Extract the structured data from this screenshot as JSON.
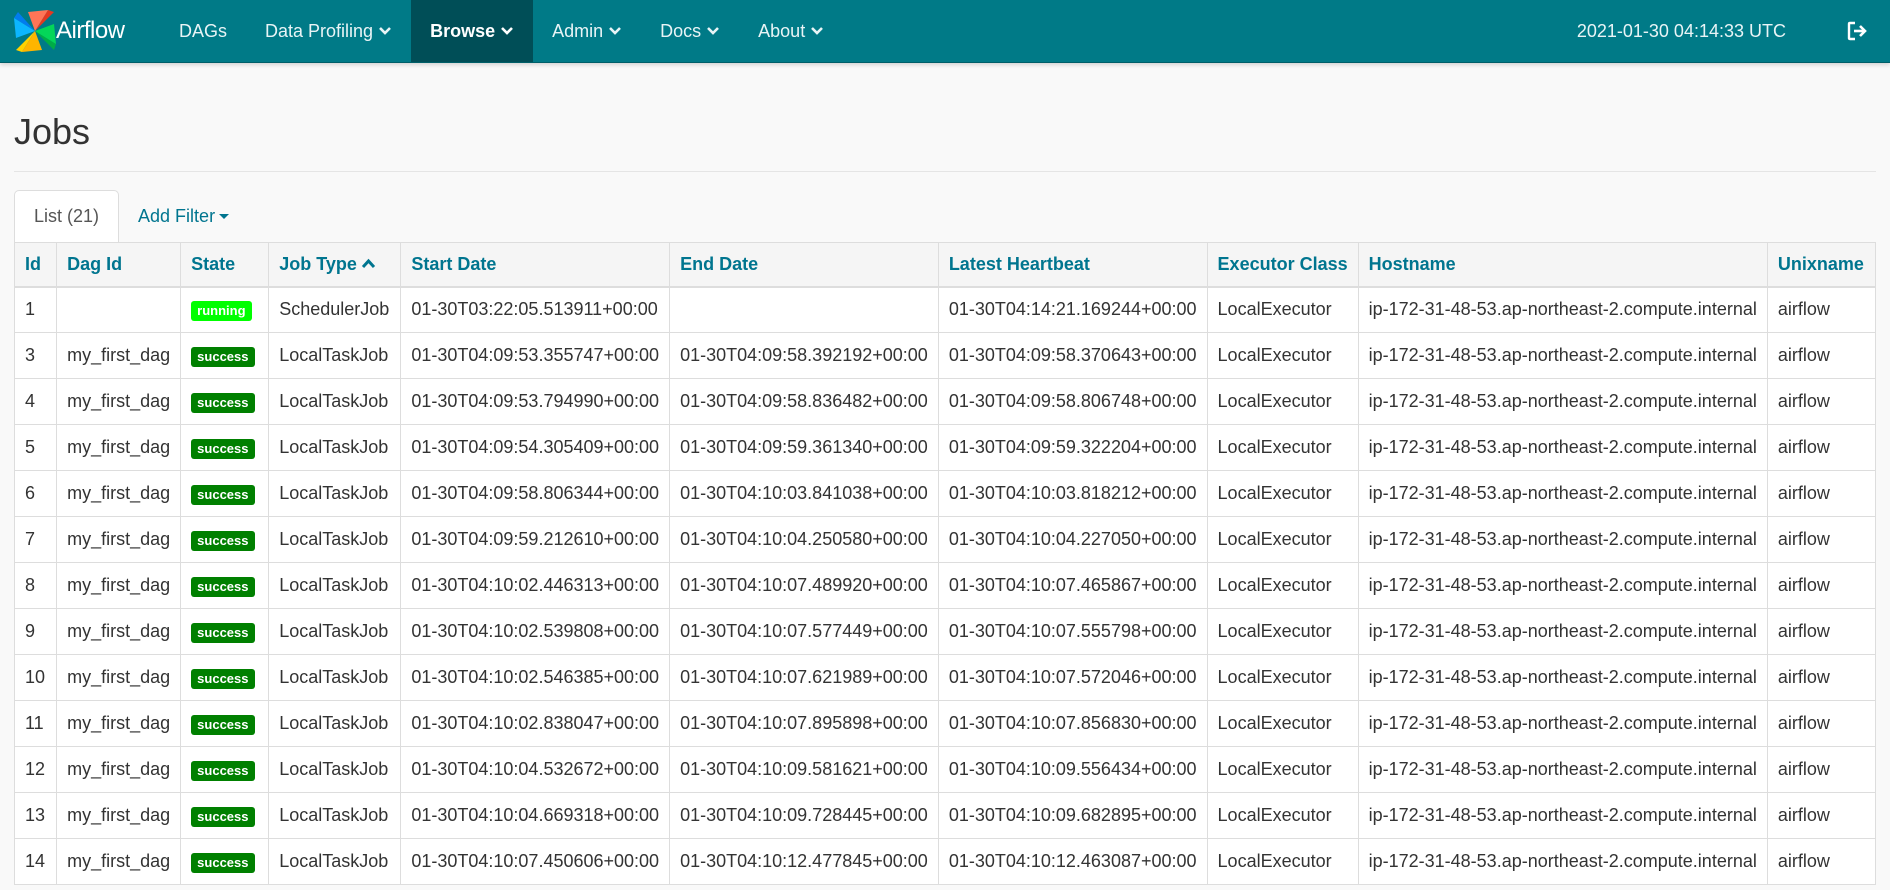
{
  "navbar": {
    "brand": "Airflow",
    "items": [
      {
        "label": "DAGs",
        "dropdown": false,
        "active": false
      },
      {
        "label": "Data Profiling",
        "dropdown": true,
        "active": false
      },
      {
        "label": "Browse",
        "dropdown": true,
        "active": true
      },
      {
        "label": "Admin",
        "dropdown": true,
        "active": false
      },
      {
        "label": "Docs",
        "dropdown": true,
        "active": false
      },
      {
        "label": "About",
        "dropdown": true,
        "active": false
      }
    ],
    "clock": "2021-01-30 04:14:33 UTC",
    "logout_icon": "sign-out-icon"
  },
  "page": {
    "title": "Jobs"
  },
  "tabs": {
    "list_label": "List (21)",
    "add_filter_label": "Add Filter"
  },
  "table": {
    "columns": [
      "Id",
      "Dag Id",
      "State",
      "Job Type",
      "Start Date",
      "End Date",
      "Latest Heartbeat",
      "Executor Class",
      "Hostname",
      "Unixname"
    ],
    "sorted_column": "Job Type",
    "rows": [
      {
        "id": "1",
        "dag_id": "",
        "state": "running",
        "job_type": "SchedulerJob",
        "start_date": "01-30T03:22:05.513911+00:00",
        "end_date": "",
        "latest_heartbeat": "01-30T04:14:21.169244+00:00",
        "executor_class": "LocalExecutor",
        "hostname": "ip-172-31-48-53.ap-northeast-2.compute.internal",
        "unixname": "airflow"
      },
      {
        "id": "3",
        "dag_id": "my_first_dag",
        "state": "success",
        "job_type": "LocalTaskJob",
        "start_date": "01-30T04:09:53.355747+00:00",
        "end_date": "01-30T04:09:58.392192+00:00",
        "latest_heartbeat": "01-30T04:09:58.370643+00:00",
        "executor_class": "LocalExecutor",
        "hostname": "ip-172-31-48-53.ap-northeast-2.compute.internal",
        "unixname": "airflow"
      },
      {
        "id": "4",
        "dag_id": "my_first_dag",
        "state": "success",
        "job_type": "LocalTaskJob",
        "start_date": "01-30T04:09:53.794990+00:00",
        "end_date": "01-30T04:09:58.836482+00:00",
        "latest_heartbeat": "01-30T04:09:58.806748+00:00",
        "executor_class": "LocalExecutor",
        "hostname": "ip-172-31-48-53.ap-northeast-2.compute.internal",
        "unixname": "airflow"
      },
      {
        "id": "5",
        "dag_id": "my_first_dag",
        "state": "success",
        "job_type": "LocalTaskJob",
        "start_date": "01-30T04:09:54.305409+00:00",
        "end_date": "01-30T04:09:59.361340+00:00",
        "latest_heartbeat": "01-30T04:09:59.322204+00:00",
        "executor_class": "LocalExecutor",
        "hostname": "ip-172-31-48-53.ap-northeast-2.compute.internal",
        "unixname": "airflow"
      },
      {
        "id": "6",
        "dag_id": "my_first_dag",
        "state": "success",
        "job_type": "LocalTaskJob",
        "start_date": "01-30T04:09:58.806344+00:00",
        "end_date": "01-30T04:10:03.841038+00:00",
        "latest_heartbeat": "01-30T04:10:03.818212+00:00",
        "executor_class": "LocalExecutor",
        "hostname": "ip-172-31-48-53.ap-northeast-2.compute.internal",
        "unixname": "airflow"
      },
      {
        "id": "7",
        "dag_id": "my_first_dag",
        "state": "success",
        "job_type": "LocalTaskJob",
        "start_date": "01-30T04:09:59.212610+00:00",
        "end_date": "01-30T04:10:04.250580+00:00",
        "latest_heartbeat": "01-30T04:10:04.227050+00:00",
        "executor_class": "LocalExecutor",
        "hostname": "ip-172-31-48-53.ap-northeast-2.compute.internal",
        "unixname": "airflow"
      },
      {
        "id": "8",
        "dag_id": "my_first_dag",
        "state": "success",
        "job_type": "LocalTaskJob",
        "start_date": "01-30T04:10:02.446313+00:00",
        "end_date": "01-30T04:10:07.489920+00:00",
        "latest_heartbeat": "01-30T04:10:07.465867+00:00",
        "executor_class": "LocalExecutor",
        "hostname": "ip-172-31-48-53.ap-northeast-2.compute.internal",
        "unixname": "airflow"
      },
      {
        "id": "9",
        "dag_id": "my_first_dag",
        "state": "success",
        "job_type": "LocalTaskJob",
        "start_date": "01-30T04:10:02.539808+00:00",
        "end_date": "01-30T04:10:07.577449+00:00",
        "latest_heartbeat": "01-30T04:10:07.555798+00:00",
        "executor_class": "LocalExecutor",
        "hostname": "ip-172-31-48-53.ap-northeast-2.compute.internal",
        "unixname": "airflow"
      },
      {
        "id": "10",
        "dag_id": "my_first_dag",
        "state": "success",
        "job_type": "LocalTaskJob",
        "start_date": "01-30T04:10:02.546385+00:00",
        "end_date": "01-30T04:10:07.621989+00:00",
        "latest_heartbeat": "01-30T04:10:07.572046+00:00",
        "executor_class": "LocalExecutor",
        "hostname": "ip-172-31-48-53.ap-northeast-2.compute.internal",
        "unixname": "airflow"
      },
      {
        "id": "11",
        "dag_id": "my_first_dag",
        "state": "success",
        "job_type": "LocalTaskJob",
        "start_date": "01-30T04:10:02.838047+00:00",
        "end_date": "01-30T04:10:07.895898+00:00",
        "latest_heartbeat": "01-30T04:10:07.856830+00:00",
        "executor_class": "LocalExecutor",
        "hostname": "ip-172-31-48-53.ap-northeast-2.compute.internal",
        "unixname": "airflow"
      },
      {
        "id": "12",
        "dag_id": "my_first_dag",
        "state": "success",
        "job_type": "LocalTaskJob",
        "start_date": "01-30T04:10:04.532672+00:00",
        "end_date": "01-30T04:10:09.581621+00:00",
        "latest_heartbeat": "01-30T04:10:09.556434+00:00",
        "executor_class": "LocalExecutor",
        "hostname": "ip-172-31-48-53.ap-northeast-2.compute.internal",
        "unixname": "airflow"
      },
      {
        "id": "13",
        "dag_id": "my_first_dag",
        "state": "success",
        "job_type": "LocalTaskJob",
        "start_date": "01-30T04:10:04.669318+00:00",
        "end_date": "01-30T04:10:09.728445+00:00",
        "latest_heartbeat": "01-30T04:10:09.682895+00:00",
        "executor_class": "LocalExecutor",
        "hostname": "ip-172-31-48-53.ap-northeast-2.compute.internal",
        "unixname": "airflow"
      },
      {
        "id": "14",
        "dag_id": "my_first_dag",
        "state": "success",
        "job_type": "LocalTaskJob",
        "start_date": "01-30T04:10:07.450606+00:00",
        "end_date": "01-30T04:10:12.477845+00:00",
        "latest_heartbeat": "01-30T04:10:12.463087+00:00",
        "executor_class": "LocalExecutor",
        "hostname": "ip-172-31-48-53.ap-northeast-2.compute.internal",
        "unixname": "airflow"
      }
    ]
  },
  "colors": {
    "navbar": "#007a87",
    "navbar_active": "#004e57",
    "link": "#00758f",
    "success": "#008000",
    "running": "#00ff00"
  }
}
